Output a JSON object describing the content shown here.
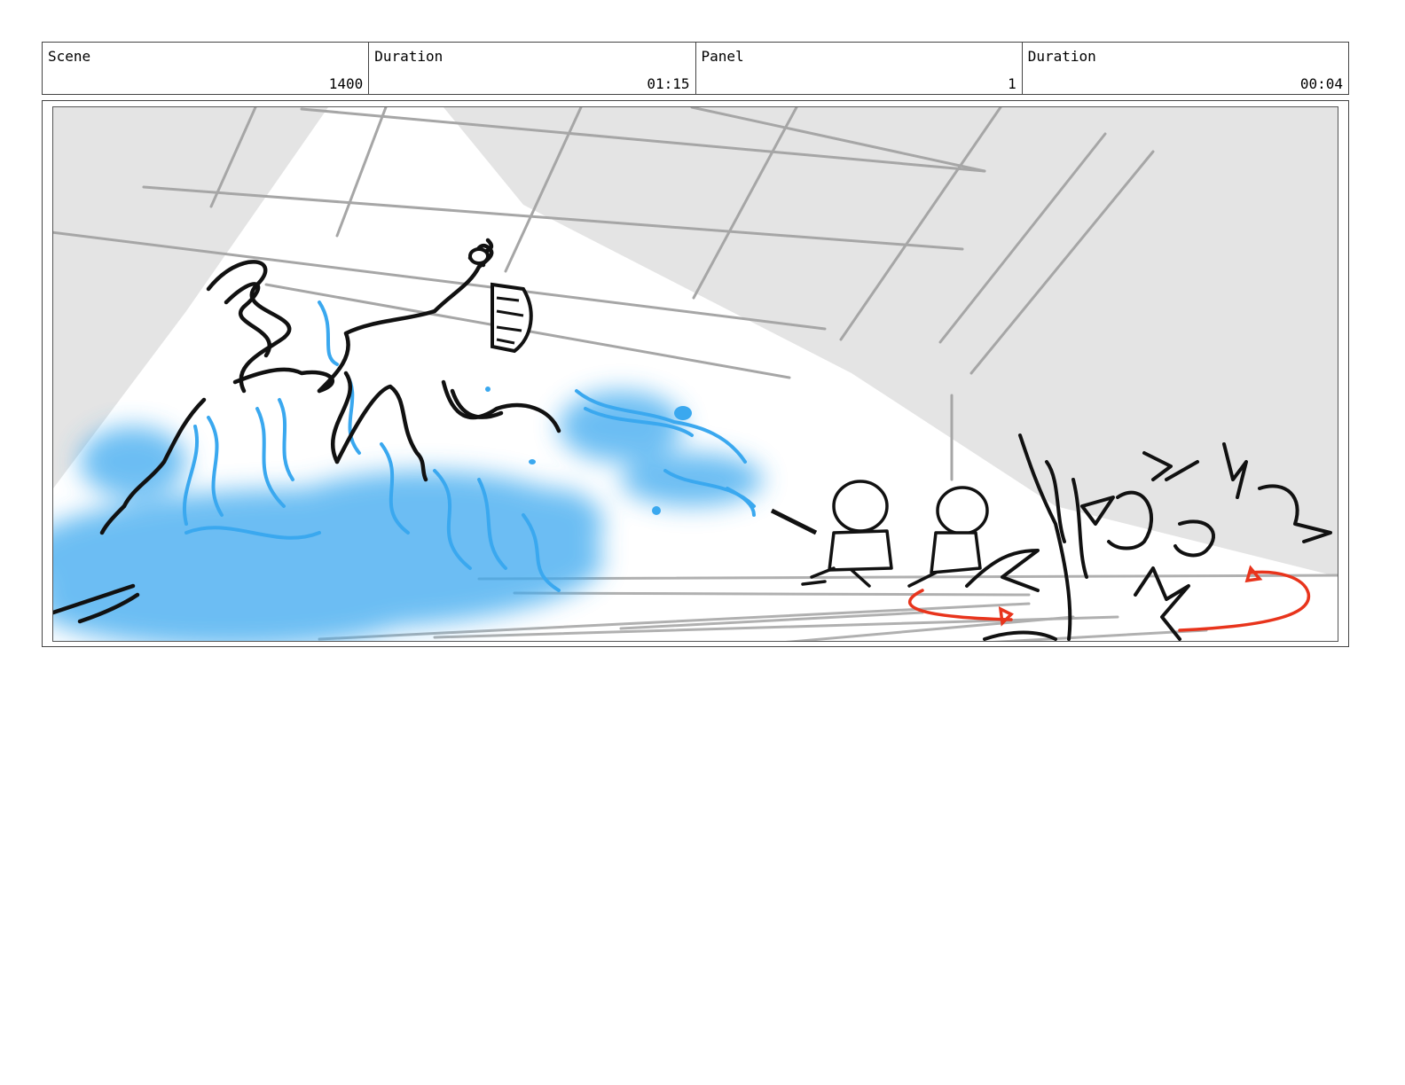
{
  "header": {
    "cells": [
      {
        "label": "Scene",
        "value": "1400"
      },
      {
        "label": "Duration",
        "value": "01:15"
      },
      {
        "label": "Panel",
        "value": "1"
      },
      {
        "label": "Duration",
        "value": "00:04"
      }
    ]
  },
  "panel": {
    "colors": {
      "background": "#e4e4e4",
      "light_beam": "#ffffff",
      "ink": "#111111",
      "water": "#3aa8ef",
      "motion_arrow": "#e8341c",
      "guide_lines": "#a6a6a6"
    }
  }
}
